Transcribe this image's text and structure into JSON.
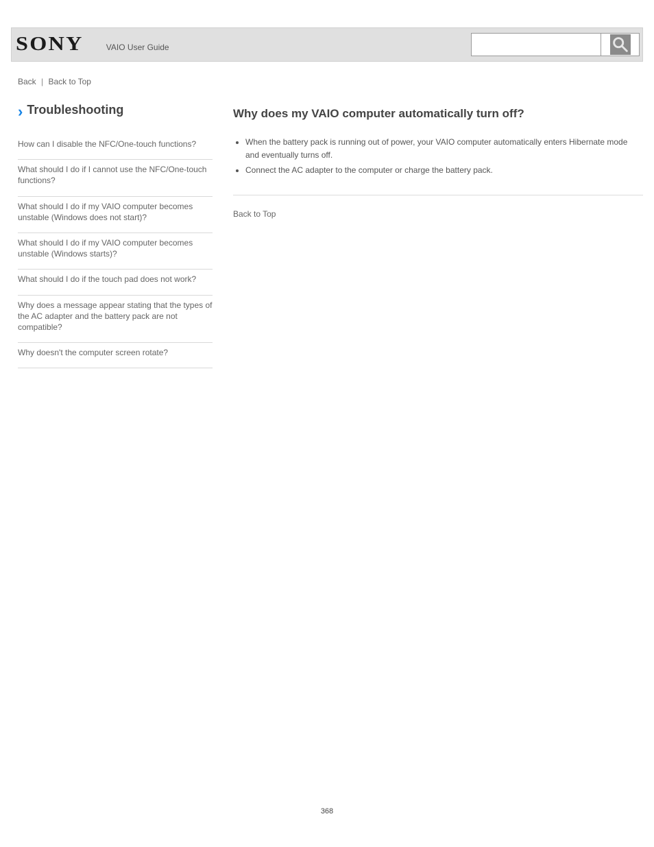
{
  "header": {
    "brand": "SONY",
    "product_line": "VAIO User Guide",
    "search_placeholder": ""
  },
  "breadcrumb": {
    "back": "Back",
    "top_link": "Back to Top"
  },
  "sidebar": {
    "section_title": "Troubleshooting",
    "items": [
      {
        "label": "How can I disable the NFC/One-touch functions?"
      },
      {
        "label": "What should I do if I cannot use the NFC/One-touch functions?"
      },
      {
        "label": "What should I do if my VAIO computer becomes unstable (Windows does not start)?"
      },
      {
        "label": "What should I do if my VAIO computer becomes unstable (Windows starts)?"
      },
      {
        "label": "What should I do if the touch pad does not work?"
      },
      {
        "label": "Why does a message appear stating that the types of the AC adapter and the battery pack are not compatible?"
      },
      {
        "label": "Why doesn't the computer screen rotate?"
      }
    ]
  },
  "article": {
    "title": "Why does my VAIO computer automatically turn off?",
    "bullets": [
      "When the battery pack is running out of power, your VAIO computer automatically enters Hibernate mode and eventually turns off.",
      "Connect the AC adapter to the computer or charge the battery pack."
    ]
  },
  "footer": {
    "page_number": "368"
  }
}
